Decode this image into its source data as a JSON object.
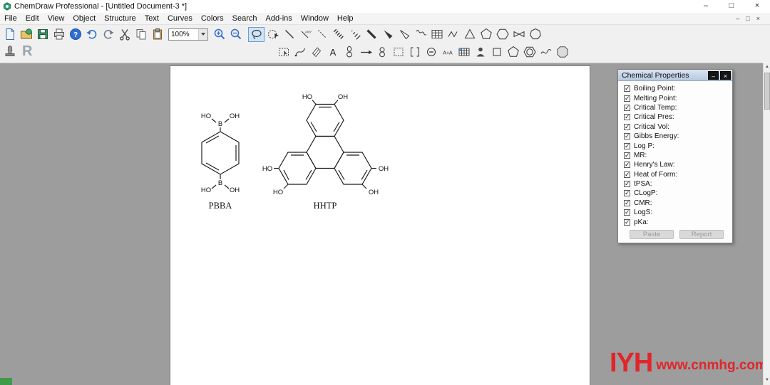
{
  "window": {
    "title": "ChemDraw Professional - [Untitled Document-3 *]",
    "minimize_glyph": "–",
    "maximize_glyph": "□",
    "close_glyph": "×"
  },
  "menus": [
    "File",
    "Edit",
    "View",
    "Object",
    "Structure",
    "Text",
    "Curves",
    "Colors",
    "Search",
    "Add-ins",
    "Window",
    "Help"
  ],
  "mdi_controls": {
    "minimize": "–",
    "restore": "□",
    "close": "×"
  },
  "toolbar": {
    "zoom_value": "100%",
    "any_bond_label": "ANY",
    "help_glyph": "?",
    "text_tool_glyph": "A",
    "a_plus_a_glyph": "A+A",
    "r_glyph": "R"
  },
  "canvas": {
    "pbba": {
      "name": "PBBA",
      "top_left": "HO",
      "top_b": "B",
      "top_right": "OH",
      "bottom_left": "HO",
      "bottom_b": "B",
      "bottom_right": "OH"
    },
    "hhtp": {
      "name": "HHTP",
      "top_left": "HO",
      "top_right": "OH",
      "left": "HO",
      "bottom_left": "HO",
      "right": "OH",
      "bottom_right": "OH"
    }
  },
  "properties_panel": {
    "title": "Chemical Properties",
    "check_glyph": "✓",
    "properties": [
      "Boiling Point:",
      "Melting Point:",
      "Critical Temp:",
      "Critical Pres:",
      "Critical Vol:",
      "Gibbs Energy:",
      "Log P:",
      "MR:",
      "Henry's Law:",
      "Heat of Form:",
      "tPSA:",
      "CLogP:",
      "CMR:",
      "LogS:",
      "pKa:"
    ],
    "paste_button": "Paste",
    "report_button": "Report",
    "minimize_glyph": "–",
    "close_glyph": "×"
  },
  "watermark": {
    "logo": "IYH",
    "site": "www.cnmhg.com"
  },
  "scrollbar": {
    "up_glyph": "▲",
    "down_glyph": "▼"
  }
}
